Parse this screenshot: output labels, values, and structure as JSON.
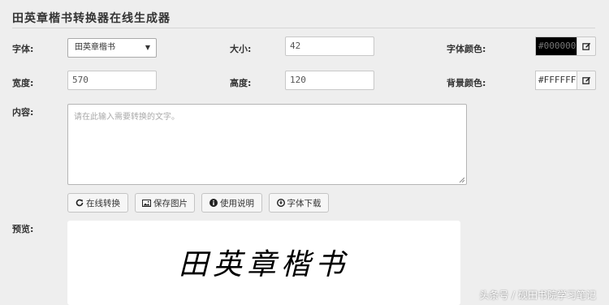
{
  "page": {
    "title": "田英章楷书转换器在线生成器"
  },
  "form": {
    "font_label": "字体:",
    "font_value": "田英章楷书",
    "size_label": "大小:",
    "size_value": "42",
    "font_color_label": "字体颜色:",
    "font_color_value": "#000000",
    "width_label": "宽度:",
    "width_value": "570",
    "height_label": "高度:",
    "height_value": "120",
    "bg_color_label": "背景颜色:",
    "bg_color_value": "#FFFFFF",
    "content_label": "内容:",
    "content_placeholder": "请在此输入需要转换的文字。",
    "preview_label": "预览:"
  },
  "buttons": {
    "convert": "在线转换",
    "save": "保存图片",
    "help": "使用说明",
    "download": "字体下载"
  },
  "preview": {
    "text": "田英章楷书"
  },
  "watermark": {
    "text": "头条号 / 砚田书院学习笔记"
  },
  "colors": {
    "font_color_swatch": "#000000",
    "bg_color_swatch": "#FFFFFF",
    "page_bg": "#eeeeee"
  },
  "icons": {
    "color_picker": "edit-icon",
    "convert": "refresh-icon",
    "save": "image-icon",
    "help": "info-icon",
    "download": "download-icon"
  }
}
